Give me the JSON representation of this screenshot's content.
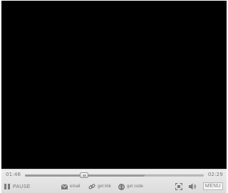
{
  "player": {
    "current_time": "01:46",
    "total_time": "02:29",
    "progress": 0.33,
    "buffered": 0.67
  },
  "controls": {
    "pause_label": "PAUSE",
    "email_label": "email",
    "link_label": "get link",
    "code_label": "get code",
    "menu_label": "MENU"
  },
  "icons": {
    "pause": "pause-icon",
    "email": "envelope-icon",
    "link": "chain-link-icon",
    "code": "embed-code-icon",
    "fullscreen": "fullscreen-icon",
    "volume": "speaker-icon"
  },
  "colors": {
    "video_background": "#000000",
    "controls_background": "#e4e4e4",
    "control_text": "#777777"
  }
}
